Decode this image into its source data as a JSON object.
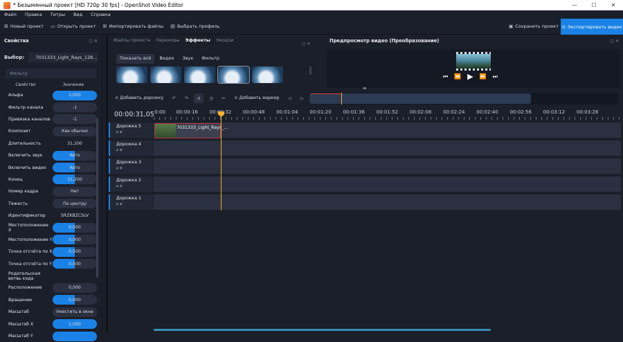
{
  "window": {
    "title": "* Безымянный проект [HD 720p 30 fps] - OpenShot Video Editor",
    "min": "—",
    "max": "☐",
    "close": "✕"
  },
  "menu": [
    "Файл",
    "Правка",
    "Титры",
    "Вид",
    "Справка"
  ],
  "toolbar": {
    "new_project": "Новый проект",
    "open_project": "Открыть проект",
    "import_files": "Импортировать файлы",
    "choose_profile": "Выбрать профиль",
    "save_project": "Сохранить проект",
    "export_video": "Экспортировать видео"
  },
  "properties": {
    "title": "Свойства",
    "ctl": "▢ ✕",
    "selection_label": "Выбор:",
    "selection_value": "7031333_Light_Rays_128...",
    "filter_placeholder": "Фильтр",
    "col_property": "Свойство",
    "col_value": "Значение",
    "rows": [
      {
        "name": "Альфа",
        "value": "1,000",
        "fill": 1.0
      },
      {
        "name": "Фильтр канала",
        "value": "-1",
        "fill": 0
      },
      {
        "name": "Привязка каналов",
        "value": "-1",
        "fill": 0
      },
      {
        "name": "Композит",
        "value": "Как обычно",
        "fill": 0
      },
      {
        "name": "Длительность",
        "value": "31,200",
        "fill": -1
      },
      {
        "name": "Включить звук",
        "value": "Авто",
        "fill": 0.5
      },
      {
        "name": "Включить видео",
        "value": "Авто",
        "fill": 0.5
      },
      {
        "name": "Конец",
        "value": "31,200",
        "fill": 0.5
      },
      {
        "name": "Номер кадра",
        "value": "Нет",
        "fill": 0
      },
      {
        "name": "Тяжесть",
        "value": "По центру",
        "fill": 0
      },
      {
        "name": "Идентификатор",
        "value": "SRZKBZCSLV",
        "fill": -1
      },
      {
        "name": "Местоположение X",
        "value": "0,000",
        "fill": 0.5
      },
      {
        "name": "Местоположение Y",
        "value": "0,000",
        "fill": 0.5
      },
      {
        "name": "Точка отсчёта по X",
        "value": "0,500",
        "fill": 0.5
      },
      {
        "name": "Точка отсчёта по Y",
        "value": "0,500",
        "fill": 0.5
      },
      {
        "name": "Родительская ветвь кода",
        "value": "",
        "fill": -1
      },
      {
        "name": "Расположение",
        "value": "0,000",
        "fill": 0
      },
      {
        "name": "Вращение",
        "value": "0,000",
        "fill": 0.5
      },
      {
        "name": "Масштаб",
        "value": "Уместить в окне",
        "fill": 0
      },
      {
        "name": "Масштаб X",
        "value": "1,000",
        "fill": 1.0
      },
      {
        "name": "Масштаб Y",
        "value": "",
        "fill": 1.0
      }
    ]
  },
  "files": {
    "tabs": [
      "Файлы проекта",
      "Переходы",
      "Эффекты",
      "Эмодзи"
    ],
    "active_tab": 2,
    "ctl": "▢ ✕",
    "subtabs": [
      "Показать всё",
      "Видео",
      "Звук",
      "Фильтр"
    ]
  },
  "preview": {
    "title": "Предпросмотр видео (Преобразование)",
    "ctl": "▢ ✕"
  },
  "timeline": {
    "add_track": "Добавить дорожку",
    "add_marker": "Добавить маркер",
    "current_time": "00:00:31,05",
    "ticks": [
      "0:00",
      "00:00:16",
      "00:00:32",
      "00:00:48",
      "00:01:04",
      "00:01:20",
      "00:01:36",
      "00:01:52",
      "00:02:08",
      "00:02:24",
      "00:02:40",
      "00:02:56",
      "00:03:12",
      "00:03:28"
    ],
    "tracks": [
      "Дорожка 5",
      "Дорожка 4",
      "Дорожка 3",
      "Дорожка 2",
      "Дорожка 1"
    ],
    "clip_title": "7031333_Light_Rays_..."
  }
}
